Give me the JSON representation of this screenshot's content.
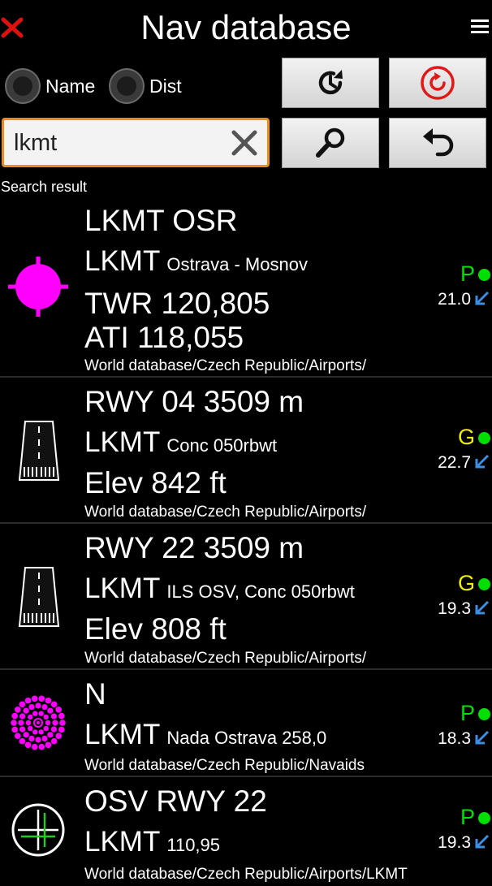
{
  "header": {
    "title": "Nav database"
  },
  "filters": {
    "sort_name_label": "Name",
    "sort_dist_label": "Dist"
  },
  "search": {
    "value": "lkmt"
  },
  "results": {
    "caption": "Search result",
    "items": [
      {
        "title": "LKMT OSR",
        "icao": "LKMT",
        "desc": "Ostrava - Mosnov",
        "extra1": "TWR 120,805",
        "extra2": "ATI 118,055",
        "path": "World database/Czech Republic/Airports/",
        "status": "P",
        "status_color": "#00e000",
        "distance": "21.0"
      },
      {
        "title": "RWY 04  3509 m",
        "icao": "LKMT",
        "desc": "Conc 050rbwt",
        "extra1": "Elev 842 ft",
        "path": "World database/Czech Republic/Airports/",
        "status": "G",
        "status_color": "#f0f000",
        "distance": "22.7"
      },
      {
        "title": "RWY 22  3509 m",
        "icao": "LKMT",
        "desc": "ILS OSV, Conc 050rbwt",
        "extra1": "Elev 808 ft",
        "path": "World database/Czech Republic/Airports/",
        "status": "G",
        "status_color": "#f0f000",
        "distance": "19.3"
      },
      {
        "title": "N",
        "icao": "LKMT",
        "desc": "Nada Ostrava 258,0",
        "path": "World database/Czech Republic/Navaids",
        "status": "P",
        "status_color": "#00e000",
        "distance": "18.3"
      },
      {
        "title": "OSV RWY 22",
        "icao": "LKMT",
        "desc": "110,95",
        "path": "World database/Czech Republic/Airports/LKMT",
        "status": "P",
        "status_color": "#00e000",
        "distance": "19.3"
      }
    ]
  },
  "colors": {
    "accent": "#ef8a1f",
    "airport_icon": "#ff00ff",
    "direction_arrow": "#3a8ee6",
    "green_dot": "#00e000"
  }
}
